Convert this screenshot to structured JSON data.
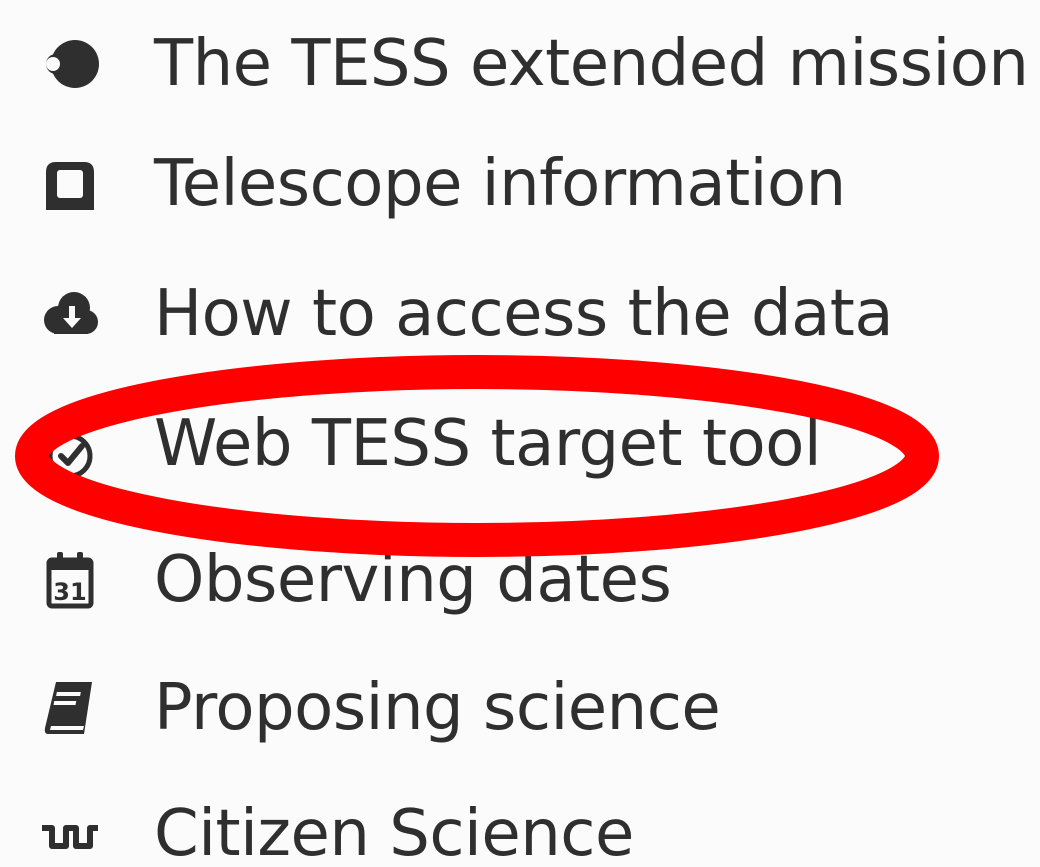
{
  "menu": {
    "items": [
      {
        "label": "The TESS extended mission",
        "icon": "moon-icon"
      },
      {
        "label": "Telescope information",
        "icon": "telescope-icon"
      },
      {
        "label": "How to access the data",
        "icon": "cloud-download-icon"
      },
      {
        "label": "Web TESS target tool",
        "icon": "check-circle-icon"
      },
      {
        "label": "Observing dates",
        "icon": "calendar-icon"
      },
      {
        "label": "Proposing science",
        "icon": "book-icon"
      },
      {
        "label": "Citizen Science",
        "icon": "wave-icon"
      }
    ],
    "calendar_day": "31",
    "highlighted_item": "Web TESS target tool"
  },
  "colors": {
    "text": "#2f2f2f",
    "highlight": "#ff0000",
    "background": "#fbfbfb"
  }
}
